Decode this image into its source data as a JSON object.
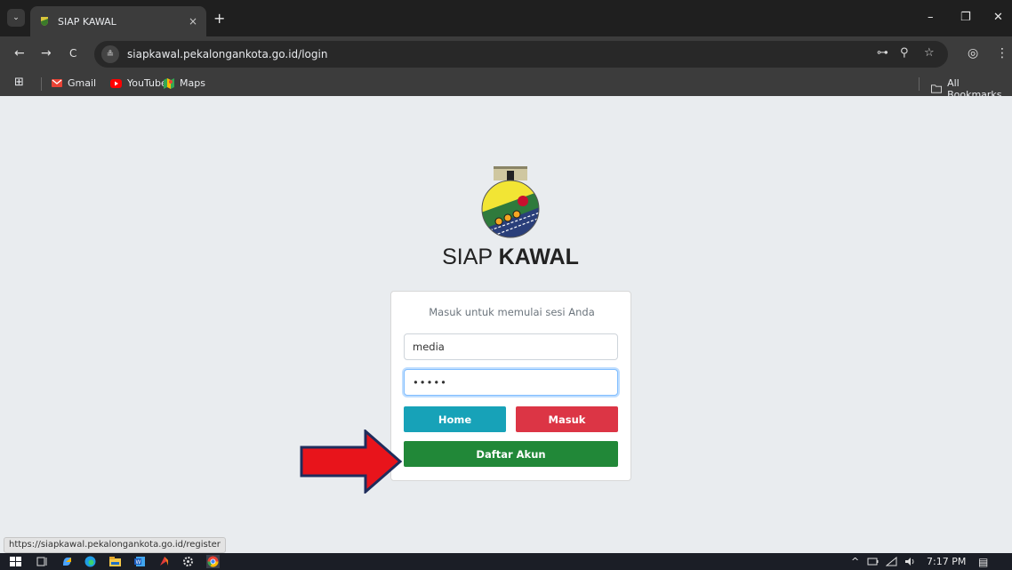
{
  "browser": {
    "tab_title": "SIAP KAWAL",
    "tab_list_glyph": "⌄",
    "tab_close": "×",
    "new_tab": "+",
    "window_minimize": "–",
    "window_restore": "❐",
    "window_close": "✕",
    "back": "←",
    "forward": "→",
    "reload": "C",
    "site_info_glyph": "≗",
    "url": "siapkawal.pekalongankota.go.id/login",
    "password_key_glyph": "⊶",
    "zoom_glyph": "⚲",
    "bookmark_star": "☆",
    "profile_glyph": "◎",
    "menu_glyph": "⋮",
    "bookmarks": {
      "apps_glyph": "⊞",
      "items": [
        {
          "label": "Gmail",
          "icon": "gmail-icon"
        },
        {
          "label": "YouTube",
          "icon": "youtube-icon"
        },
        {
          "label": "Maps",
          "icon": "maps-icon"
        }
      ],
      "all_bookmarks": "All Bookmarks"
    }
  },
  "login": {
    "brand_light": "SIAP ",
    "brand_bold": "KAWAL",
    "message": "Masuk untuk memulai sesi Anda",
    "username_value": "media",
    "password_value": "•••••",
    "home_button": "Home",
    "masuk_button": "Masuk",
    "daftar_button": "Daftar Akun"
  },
  "status_url": "https://siapkawal.pekalongankota.go.id/register",
  "taskbar": {
    "tray_chevron": "^",
    "time": "7:17 PM",
    "notification_glyph": "▤"
  },
  "colors": {
    "home": "#17a2b8",
    "masuk": "#dc3545",
    "daftar": "#218838",
    "arrow": "#e8141b"
  }
}
